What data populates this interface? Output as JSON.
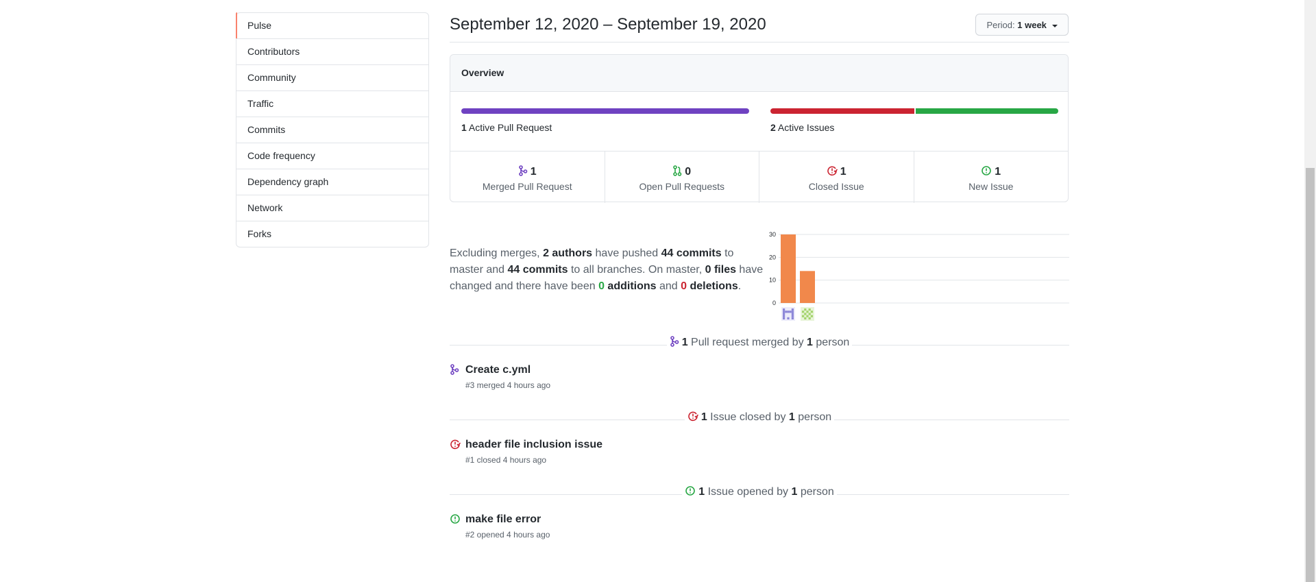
{
  "sidebar": {
    "items": [
      {
        "label": "Pulse",
        "selected": true
      },
      {
        "label": "Contributors"
      },
      {
        "label": "Community"
      },
      {
        "label": "Traffic"
      },
      {
        "label": "Commits"
      },
      {
        "label": "Code frequency"
      },
      {
        "label": "Dependency graph"
      },
      {
        "label": "Network"
      },
      {
        "label": "Forks"
      }
    ]
  },
  "header": {
    "date_range": "September 12, 2020 – September 19, 2020",
    "period_label": "Period:",
    "period_value": "1 week"
  },
  "overview": {
    "title": "Overview",
    "pull_requests": {
      "count": "1",
      "label": "Active Pull Request",
      "color": "#6f42c1"
    },
    "issues": {
      "count": "2",
      "label": "Active Issues",
      "closed_color": "#cb2431",
      "open_color": "#28a745",
      "closed_fraction": 0.5
    },
    "stats": [
      {
        "num": "1",
        "label": "Merged Pull Request",
        "icon": "merge-icon",
        "color": "#6f42c1"
      },
      {
        "num": "0",
        "label": "Open Pull Requests",
        "icon": "pull-request-icon",
        "color": "#28a745"
      },
      {
        "num": "1",
        "label": "Closed Issue",
        "icon": "issue-closed-icon",
        "color": "#cb2431"
      },
      {
        "num": "1",
        "label": "New Issue",
        "icon": "issue-opened-icon",
        "color": "#28a745"
      }
    ]
  },
  "summary": {
    "p1": "Excluding merges, ",
    "authors": "2 authors",
    "p2": " have pushed ",
    "commits_master": "44 commits",
    "p3": " to master and ",
    "commits_all": "44 commits",
    "p4": " to all branches. On master, ",
    "files": "0 files",
    "p5": " have changed and there have been ",
    "additions_num": "0",
    "additions_word": " additions",
    "p6": " and ",
    "deletions_num": "0",
    "deletions_word": " deletions",
    "p7": "."
  },
  "chart_data": {
    "type": "bar",
    "categories": [
      "author-1",
      "author-2"
    ],
    "values": [
      30,
      14
    ],
    "yticks": [
      0,
      10,
      20,
      30
    ],
    "ylim": [
      0,
      30
    ],
    "bar_color": "#f1884b",
    "grid": true
  },
  "sections": [
    {
      "icon": "merge-icon",
      "color": "#6f42c1",
      "count": "1",
      "text": "Pull request merged by",
      "people": "1",
      "people_word": "person",
      "item": {
        "title": "Create c.yml",
        "meta": "#3 merged 4 hours ago"
      }
    },
    {
      "icon": "issue-closed-icon",
      "color": "#cb2431",
      "count": "1",
      "text": "Issue closed by",
      "people": "1",
      "people_word": "person",
      "item": {
        "title": "header file inclusion issue",
        "meta": "#1 closed 4 hours ago"
      }
    },
    {
      "icon": "issue-opened-icon",
      "color": "#28a745",
      "count": "1",
      "text": "Issue opened by",
      "people": "1",
      "people_word": "person",
      "item": {
        "title": "make file error",
        "meta": "#2 opened 4 hours ago"
      }
    }
  ]
}
